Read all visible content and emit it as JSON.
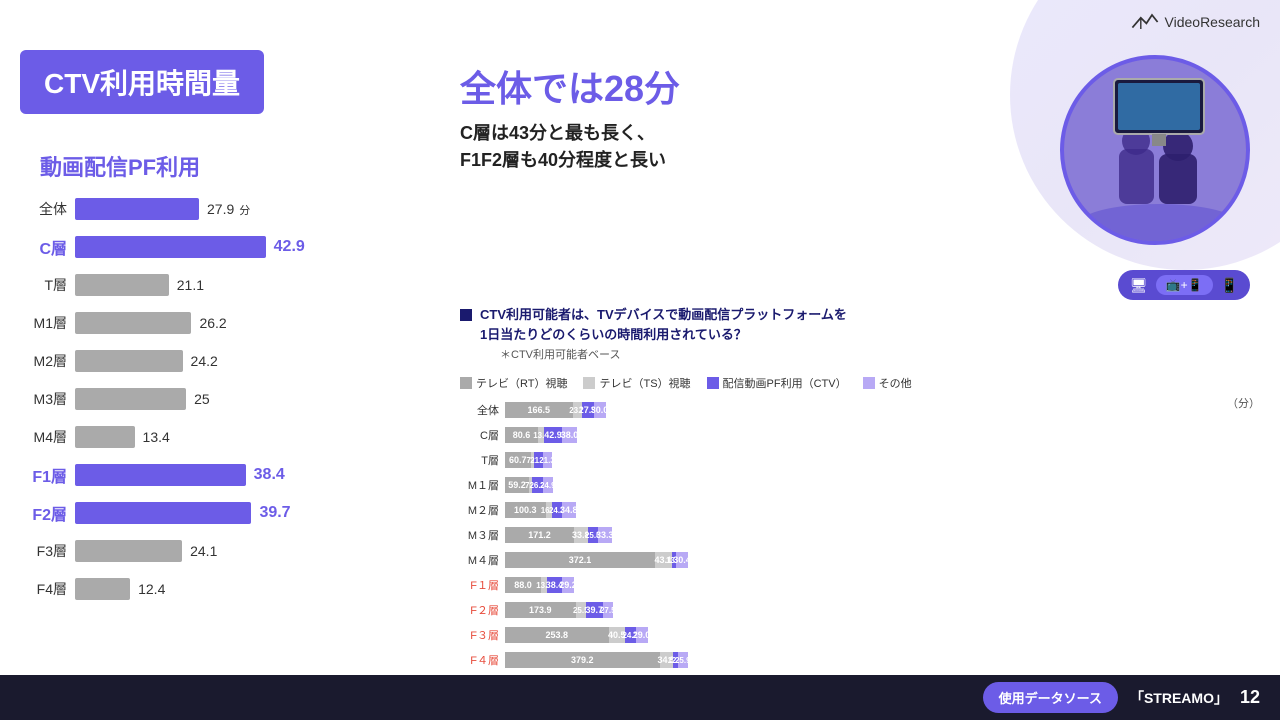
{
  "header": {
    "logo_text": "VideoResearch"
  },
  "title_box": {
    "text": "CTV利用時間量"
  },
  "subtitle": "動画配信PF利用",
  "main_title": "全体では28分",
  "sub_desc_line1": "C層は43分と最も長く、",
  "sub_desc_line2": "F1F2層も40分程度と長い",
  "question": {
    "text": "CTV利用可能者は、TVデバイスで動画配信プラットフォームを\n1日当たりどのくらいの時間利用されている？",
    "note": "＊CTV利用可能者ベース"
  },
  "legend": [
    {
      "label": "テレビ（RT）視聴",
      "color": "#aaa"
    },
    {
      "label": "テレビ（TS）視聴",
      "color": "#ccc"
    },
    {
      "label": "配信動画PF利用（CTV）",
      "color": "#6c5ce7"
    },
    {
      "label": "その他",
      "color": "#b8a9f5"
    }
  ],
  "left_bars": [
    {
      "label": "全体",
      "value": 27.9,
      "unit": "分",
      "type": "purple",
      "highlight": false
    },
    {
      "label": "C層",
      "value": 42.9,
      "type": "purple",
      "highlight": "c"
    },
    {
      "label": "T層",
      "value": 21.1,
      "type": "gray",
      "highlight": false
    },
    {
      "label": "M1層",
      "value": 26.2,
      "type": "gray",
      "highlight": false
    },
    {
      "label": "M2層",
      "value": 24.2,
      "type": "gray",
      "highlight": false
    },
    {
      "label": "M3層",
      "value": 25.0,
      "type": "gray",
      "highlight": false
    },
    {
      "label": "M4層",
      "value": 13.4,
      "type": "gray",
      "highlight": false
    },
    {
      "label": "F1層",
      "value": 38.4,
      "type": "purple",
      "highlight": "f"
    },
    {
      "label": "F2層",
      "value": 39.7,
      "type": "purple",
      "highlight": "f"
    },
    {
      "label": "F3層",
      "value": 24.1,
      "type": "gray",
      "highlight": false
    },
    {
      "label": "F4層",
      "value": 12.4,
      "type": "gray",
      "highlight": false
    }
  ],
  "stacked_rows": [
    {
      "label": "全体",
      "segs": [
        {
          "pct": 45,
          "val": "166.5",
          "cls": "s1"
        },
        {
          "pct": 6,
          "val": "23.2",
          "cls": "s2"
        },
        {
          "pct": 8,
          "val": "27.9",
          "cls": "s3"
        },
        {
          "pct": 8,
          "val": "30.0",
          "cls": "s4"
        }
      ],
      "pink": false
    },
    {
      "label": "C層",
      "segs": [
        {
          "pct": 22,
          "val": "80.6",
          "cls": "s1"
        },
        {
          "pct": 4,
          "val": "13.7",
          "cls": "s2"
        },
        {
          "pct": 12,
          "val": "42.9",
          "cls": "s3"
        },
        {
          "pct": 10,
          "val": "38.0",
          "cls": "s4"
        }
      ],
      "pink": false
    },
    {
      "label": "T層",
      "segs": [
        {
          "pct": 17,
          "val": "60.7",
          "cls": "s1"
        },
        {
          "pct": 2,
          "val": "7.6",
          "cls": "s2"
        },
        {
          "pct": 6,
          "val": "21.1",
          "cls": "s3"
        },
        {
          "pct": 6,
          "val": "21.3",
          "cls": "s4"
        }
      ],
      "pink": false
    },
    {
      "label": "M１層",
      "segs": [
        {
          "pct": 16,
          "val": "59.2",
          "cls": "s1"
        },
        {
          "pct": 2,
          "val": "7.3",
          "cls": "s2"
        },
        {
          "pct": 7,
          "val": "26.2",
          "cls": "s3"
        },
        {
          "pct": 7,
          "val": "24.9",
          "cls": "s4"
        }
      ],
      "pink": false
    },
    {
      "label": "M２層",
      "segs": [
        {
          "pct": 27,
          "val": "100.3",
          "cls": "s1"
        },
        {
          "pct": 4,
          "val": "16.2",
          "cls": "s2"
        },
        {
          "pct": 7,
          "val": "24.2",
          "cls": "s3"
        },
        {
          "pct": 9,
          "val": "34.8",
          "cls": "s4"
        }
      ],
      "pink": false
    },
    {
      "label": "M３層",
      "segs": [
        {
          "pct": 46,
          "val": "171.2",
          "cls": "s1"
        },
        {
          "pct": 9,
          "val": "33.8",
          "cls": "s2"
        },
        {
          "pct": 7,
          "val": "25.0",
          "cls": "s3"
        },
        {
          "pct": 9,
          "val": "33.3",
          "cls": "s4"
        }
      ],
      "pink": false
    },
    {
      "label": "M４層",
      "segs": [
        {
          "pct": 100,
          "val": "372.1",
          "cls": "s1"
        },
        {
          "pct": 11,
          "val": "43.1",
          "cls": "s2"
        },
        {
          "pct": 3,
          "val": "13.4",
          "cls": "s3"
        },
        {
          "pct": 8,
          "val": "30.4",
          "cls": "s4"
        }
      ],
      "pink": false
    },
    {
      "label": "F１層",
      "segs": [
        {
          "pct": 24,
          "val": "88.0",
          "cls": "s1"
        },
        {
          "pct": 4,
          "val": "13.5",
          "cls": "s2"
        },
        {
          "pct": 10,
          "val": "38.4",
          "cls": "s3"
        },
        {
          "pct": 8,
          "val": "29.2",
          "cls": "s4"
        }
      ],
      "pink": true
    },
    {
      "label": "F２層",
      "segs": [
        {
          "pct": 47,
          "val": "173.9",
          "cls": "s1"
        },
        {
          "pct": 7,
          "val": "25.5",
          "cls": "s2"
        },
        {
          "pct": 11,
          "val": "39.7",
          "cls": "s3"
        },
        {
          "pct": 7,
          "val": "27.5",
          "cls": "s4"
        }
      ],
      "pink": true
    },
    {
      "label": "F３層",
      "segs": [
        {
          "pct": 69,
          "val": "253.8",
          "cls": "s1"
        },
        {
          "pct": 11,
          "val": "40.5",
          "cls": "s2"
        },
        {
          "pct": 7,
          "val": "24.1",
          "cls": "s3"
        },
        {
          "pct": 8,
          "val": "29.0",
          "cls": "s4"
        }
      ],
      "pink": true
    },
    {
      "label": "F４層",
      "segs": [
        {
          "pct": 103,
          "val": "379.2",
          "cls": "s1"
        },
        {
          "pct": 9,
          "val": "34.5",
          "cls": "s2"
        },
        {
          "pct": 3,
          "val": "12.4",
          "cls": "s3"
        },
        {
          "pct": 7,
          "val": "25.9",
          "cls": "s4"
        }
      ],
      "pink": true
    }
  ],
  "bottom": {
    "data_source_label": "使用データソース",
    "streamo": "「STREAMO」",
    "page": "12"
  }
}
